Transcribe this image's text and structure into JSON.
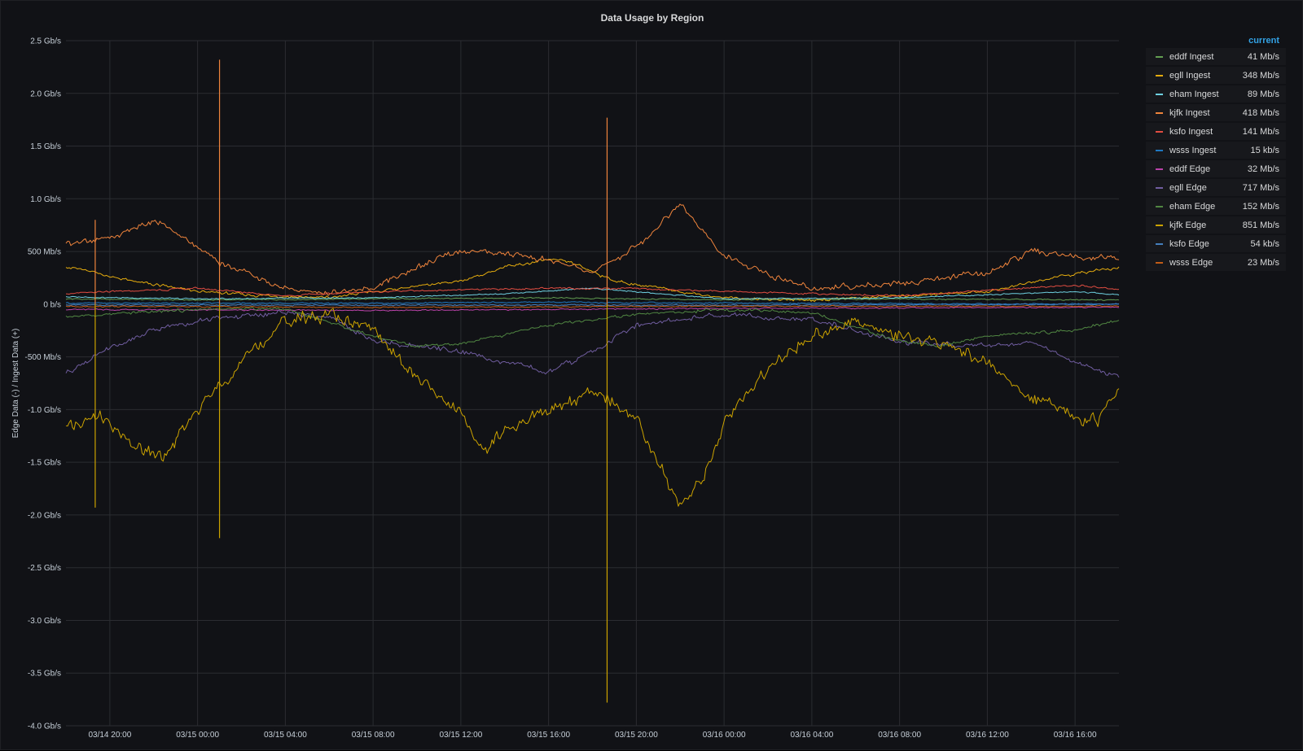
{
  "panel": {
    "title": "Data Usage by Region"
  },
  "legend": {
    "header": "current"
  },
  "chart_data": {
    "type": "line",
    "title": "Data Usage by Region",
    "ylabel": "Edge Data (-) / Ingest Data (+)",
    "xlabel": "",
    "grid": true,
    "legend_position": "right",
    "ylim_gbps": [
      -4.0,
      2.5
    ],
    "y_ticks": [
      {
        "value": 2.5,
        "label": "2.5 Gb/s"
      },
      {
        "value": 2.0,
        "label": "2.0 Gb/s"
      },
      {
        "value": 1.5,
        "label": "1.5 Gb/s"
      },
      {
        "value": 1.0,
        "label": "1.0 Gb/s"
      },
      {
        "value": 0.5,
        "label": "500 Mb/s"
      },
      {
        "value": 0.0,
        "label": "0 b/s"
      },
      {
        "value": -0.5,
        "label": "-500 Mb/s"
      },
      {
        "value": -1.0,
        "label": "-1.0 Gb/s"
      },
      {
        "value": -1.5,
        "label": "-1.5 Gb/s"
      },
      {
        "value": -2.0,
        "label": "-2.0 Gb/s"
      },
      {
        "value": -2.5,
        "label": "-2.5 Gb/s"
      },
      {
        "value": -3.0,
        "label": "-3.0 Gb/s"
      },
      {
        "value": -3.5,
        "label": "-3.5 Gb/s"
      },
      {
        "value": -4.0,
        "label": "-4.0 Gb/s"
      }
    ],
    "x_ticks": [
      "03/14 20:00",
      "03/15 00:00",
      "03/15 04:00",
      "03/15 08:00",
      "03/15 12:00",
      "03/15 16:00",
      "03/15 20:00",
      "03/16 00:00",
      "03/16 04:00",
      "03/16 08:00",
      "03/16 12:00",
      "03/16 16:00"
    ],
    "x_range": [
      "03/14 18:00",
      "03/16 18:00"
    ],
    "series": [
      {
        "name": "eddf Ingest",
        "current": "41 Mb/s",
        "color": "#629e51",
        "points": [
          [
            "03/14 18:00",
            0.05
          ],
          [
            "03/15 00:00",
            0.04
          ],
          [
            "03/15 08:00",
            0.05
          ],
          [
            "03/15 16:00",
            0.06
          ],
          [
            "03/16 00:00",
            0.04
          ],
          [
            "03/16 08:00",
            0.05
          ],
          [
            "03/16 18:00",
            0.04
          ]
        ]
      },
      {
        "name": "egll Ingest",
        "current": "348 Mb/s",
        "color": "#e5ac0e",
        "points": [
          [
            "03/14 18:00",
            0.36
          ],
          [
            "03/14 21:00",
            0.22
          ],
          [
            "03/15 00:00",
            0.12
          ],
          [
            "03/15 03:00",
            0.08
          ],
          [
            "03/15 06:00",
            0.06
          ],
          [
            "03/15 08:00",
            0.12
          ],
          [
            "03/15 12:00",
            0.22
          ],
          [
            "03/15 14:00",
            0.35
          ],
          [
            "03/15 16:00",
            0.42
          ],
          [
            "03/15 17:00",
            0.4
          ],
          [
            "03/15 19:00",
            0.22
          ],
          [
            "03/15 22:00",
            0.12
          ],
          [
            "03/16 00:00",
            0.06
          ],
          [
            "03/16 04:00",
            0.04
          ],
          [
            "03/16 08:00",
            0.08
          ],
          [
            "03/16 12:00",
            0.12
          ],
          [
            "03/16 15:00",
            0.25
          ],
          [
            "03/16 17:00",
            0.32
          ],
          [
            "03/16 18:00",
            0.35
          ]
        ]
      },
      {
        "name": "eham Ingest",
        "current": "89 Mb/s",
        "color": "#6ed0e0",
        "points": [
          [
            "03/14 18:00",
            0.07
          ],
          [
            "03/15 00:00",
            0.05
          ],
          [
            "03/15 08:00",
            0.06
          ],
          [
            "03/15 14:00",
            0.1
          ],
          [
            "03/15 18:00",
            0.15
          ],
          [
            "03/16 00:00",
            0.05
          ],
          [
            "03/16 08:00",
            0.06
          ],
          [
            "03/16 16:00",
            0.12
          ],
          [
            "03/16 18:00",
            0.09
          ]
        ]
      },
      {
        "name": "kjfk Ingest",
        "current": "418 Mb/s",
        "color": "#ef843c",
        "points": [
          [
            "03/14 18:00",
            0.58
          ],
          [
            "03/14 20:00",
            0.62
          ],
          [
            "03/14 22:00",
            0.8
          ],
          [
            "03/15 00:00",
            0.55
          ],
          [
            "03/15 01:00",
            0.4
          ],
          [
            "03/15 04:00",
            0.15
          ],
          [
            "03/15 06:00",
            0.1
          ],
          [
            "03/15 08:00",
            0.15
          ],
          [
            "03/15 10:00",
            0.35
          ],
          [
            "03/15 12:00",
            0.5
          ],
          [
            "03/15 14:00",
            0.48
          ],
          [
            "03/15 16:00",
            0.42
          ],
          [
            "03/15 18:00",
            0.3
          ],
          [
            "03/15 20:00",
            0.55
          ],
          [
            "03/15 22:00",
            0.95
          ],
          [
            "03/15 23:00",
            0.7
          ],
          [
            "03/16 00:00",
            0.45
          ],
          [
            "03/16 02:00",
            0.28
          ],
          [
            "03/16 04:00",
            0.15
          ],
          [
            "03/16 08:00",
            0.2
          ],
          [
            "03/16 12:00",
            0.3
          ],
          [
            "03/16 14:00",
            0.5
          ],
          [
            "03/16 16:00",
            0.45
          ],
          [
            "03/16 18:00",
            0.42
          ]
        ]
      },
      {
        "name": "ksfo Ingest",
        "current": "141 Mb/s",
        "color": "#e24d42",
        "points": [
          [
            "03/14 18:00",
            0.1
          ],
          [
            "03/15 00:00",
            0.15
          ],
          [
            "03/15 04:00",
            0.08
          ],
          [
            "03/15 08:00",
            0.12
          ],
          [
            "03/15 16:00",
            0.15
          ],
          [
            "03/15 20:00",
            0.15
          ],
          [
            "03/16 00:00",
            0.12
          ],
          [
            "03/16 04:00",
            0.1
          ],
          [
            "03/16 08:00",
            0.08
          ],
          [
            "03/16 16:00",
            0.18
          ],
          [
            "03/16 18:00",
            0.14
          ]
        ]
      },
      {
        "name": "wsss Ingest",
        "current": "15 kb/s",
        "color": "#1f78c1",
        "points": [
          [
            "03/14 18:00",
            0.01
          ],
          [
            "03/15 08:00",
            0.01
          ],
          [
            "03/15 16:00",
            0.02
          ],
          [
            "03/16 00:00",
            0.01
          ],
          [
            "03/16 18:00",
            0.0
          ]
        ]
      },
      {
        "name": "eddf Edge",
        "current": "32 Mb/s",
        "color": "#ba43a9",
        "points": [
          [
            "03/14 18:00",
            -0.05
          ],
          [
            "03/15 08:00",
            -0.06
          ],
          [
            "03/15 16:00",
            -0.05
          ],
          [
            "03/16 00:00",
            -0.04
          ],
          [
            "03/16 18:00",
            -0.03
          ]
        ]
      },
      {
        "name": "egll Edge",
        "current": "717 Mb/s",
        "color": "#705da0",
        "points": [
          [
            "03/14 18:00",
            -0.65
          ],
          [
            "03/14 20:00",
            -0.42
          ],
          [
            "03/14 22:00",
            -0.25
          ],
          [
            "03/15 00:00",
            -0.15
          ],
          [
            "03/15 04:00",
            -0.08
          ],
          [
            "03/15 06:00",
            -0.12
          ],
          [
            "03/15 08:00",
            -0.35
          ],
          [
            "03/15 12:00",
            -0.45
          ],
          [
            "03/15 14:00",
            -0.55
          ],
          [
            "03/15 16:00",
            -0.65
          ],
          [
            "03/15 18:00",
            -0.45
          ],
          [
            "03/15 20:00",
            -0.2
          ],
          [
            "03/16 00:00",
            -0.1
          ],
          [
            "03/16 04:00",
            -0.15
          ],
          [
            "03/16 08:00",
            -0.35
          ],
          [
            "03/16 12:00",
            -0.4
          ],
          [
            "03/16 14:00",
            -0.35
          ],
          [
            "03/16 16:00",
            -0.55
          ],
          [
            "03/16 18:00",
            -0.7
          ]
        ]
      },
      {
        "name": "eham Edge",
        "current": "152 Mb/s",
        "color": "#508642",
        "points": [
          [
            "03/14 18:00",
            -0.12
          ],
          [
            "03/15 00:00",
            -0.05
          ],
          [
            "03/15 04:00",
            -0.04
          ],
          [
            "03/15 08:00",
            -0.3
          ],
          [
            "03/15 10:00",
            -0.4
          ],
          [
            "03/15 12:00",
            -0.38
          ],
          [
            "03/15 16:00",
            -0.2
          ],
          [
            "03/15 20:00",
            -0.1
          ],
          [
            "03/16 00:00",
            -0.05
          ],
          [
            "03/16 04:00",
            -0.08
          ],
          [
            "03/16 08:00",
            -0.35
          ],
          [
            "03/16 10:00",
            -0.4
          ],
          [
            "03/16 12:00",
            -0.3
          ],
          [
            "03/16 16:00",
            -0.25
          ],
          [
            "03/16 18:00",
            -0.15
          ]
        ]
      },
      {
        "name": "kjfk Edge",
        "current": "851 Mb/s",
        "color": "#cca300",
        "points": [
          [
            "03/14 18:00",
            -1.2
          ],
          [
            "03/14 19:30",
            -1.05
          ],
          [
            "03/14 21:00",
            -1.35
          ],
          [
            "03/14 22:30",
            -1.45
          ],
          [
            "03/15 00:00",
            -1.0
          ],
          [
            "03/15 02:00",
            -0.55
          ],
          [
            "03/15 04:00",
            -0.15
          ],
          [
            "03/15 06:00",
            -0.1
          ],
          [
            "03/15 08:00",
            -0.25
          ],
          [
            "03/15 10:00",
            -0.7
          ],
          [
            "03/15 12:00",
            -1.05
          ],
          [
            "03/15 13:00",
            -1.4
          ],
          [
            "03/15 14:00",
            -1.2
          ],
          [
            "03/15 16:00",
            -1.0
          ],
          [
            "03/15 18:00",
            -0.85
          ],
          [
            "03/15 20:00",
            -1.05
          ],
          [
            "03/15 21:00",
            -1.5
          ],
          [
            "03/15 22:00",
            -1.9
          ],
          [
            "03/15 23:00",
            -1.7
          ],
          [
            "03/16 00:00",
            -1.1
          ],
          [
            "03/16 02:00",
            -0.6
          ],
          [
            "03/16 04:00",
            -0.3
          ],
          [
            "03/16 06:00",
            -0.18
          ],
          [
            "03/16 08:00",
            -0.3
          ],
          [
            "03/16 10:00",
            -0.4
          ],
          [
            "03/16 12:00",
            -0.55
          ],
          [
            "03/16 14:00",
            -0.9
          ],
          [
            "03/16 16:00",
            -1.05
          ],
          [
            "03/16 17:00",
            -1.1
          ],
          [
            "03/16 18:00",
            -0.8
          ]
        ]
      },
      {
        "name": "ksfo Edge",
        "current": "54 kb/s",
        "color": "#447ebc",
        "points": [
          [
            "03/14 18:00",
            -0.01
          ],
          [
            "03/15 08:00",
            -0.01
          ],
          [
            "03/16 00:00",
            -0.01
          ],
          [
            "03/16 18:00",
            0.0
          ]
        ]
      },
      {
        "name": "wsss Edge",
        "current": "23 Mb/s",
        "color": "#c15c17",
        "points": [
          [
            "03/14 18:00",
            -0.02
          ],
          [
            "03/15 08:00",
            -0.03
          ],
          [
            "03/16 00:00",
            -0.02
          ],
          [
            "03/16 18:00",
            -0.02
          ]
        ]
      }
    ],
    "spikes": [
      {
        "series": "kjfk Ingest",
        "time": "03/15 01:00",
        "value": 2.32
      },
      {
        "series": "kjfk Ingest",
        "time": "03/15 18:40",
        "value": 1.77
      },
      {
        "series": "kjfk Edge",
        "time": "03/15 18:40",
        "value": -3.78
      },
      {
        "series": "kjfk Edge",
        "time": "03/15 01:00",
        "value": -2.22
      },
      {
        "series": "kjfk Edge",
        "time": "03/14 19:20",
        "value": -1.93
      },
      {
        "series": "kjfk Ingest",
        "time": "03/14 19:20",
        "value": 0.8
      }
    ]
  }
}
